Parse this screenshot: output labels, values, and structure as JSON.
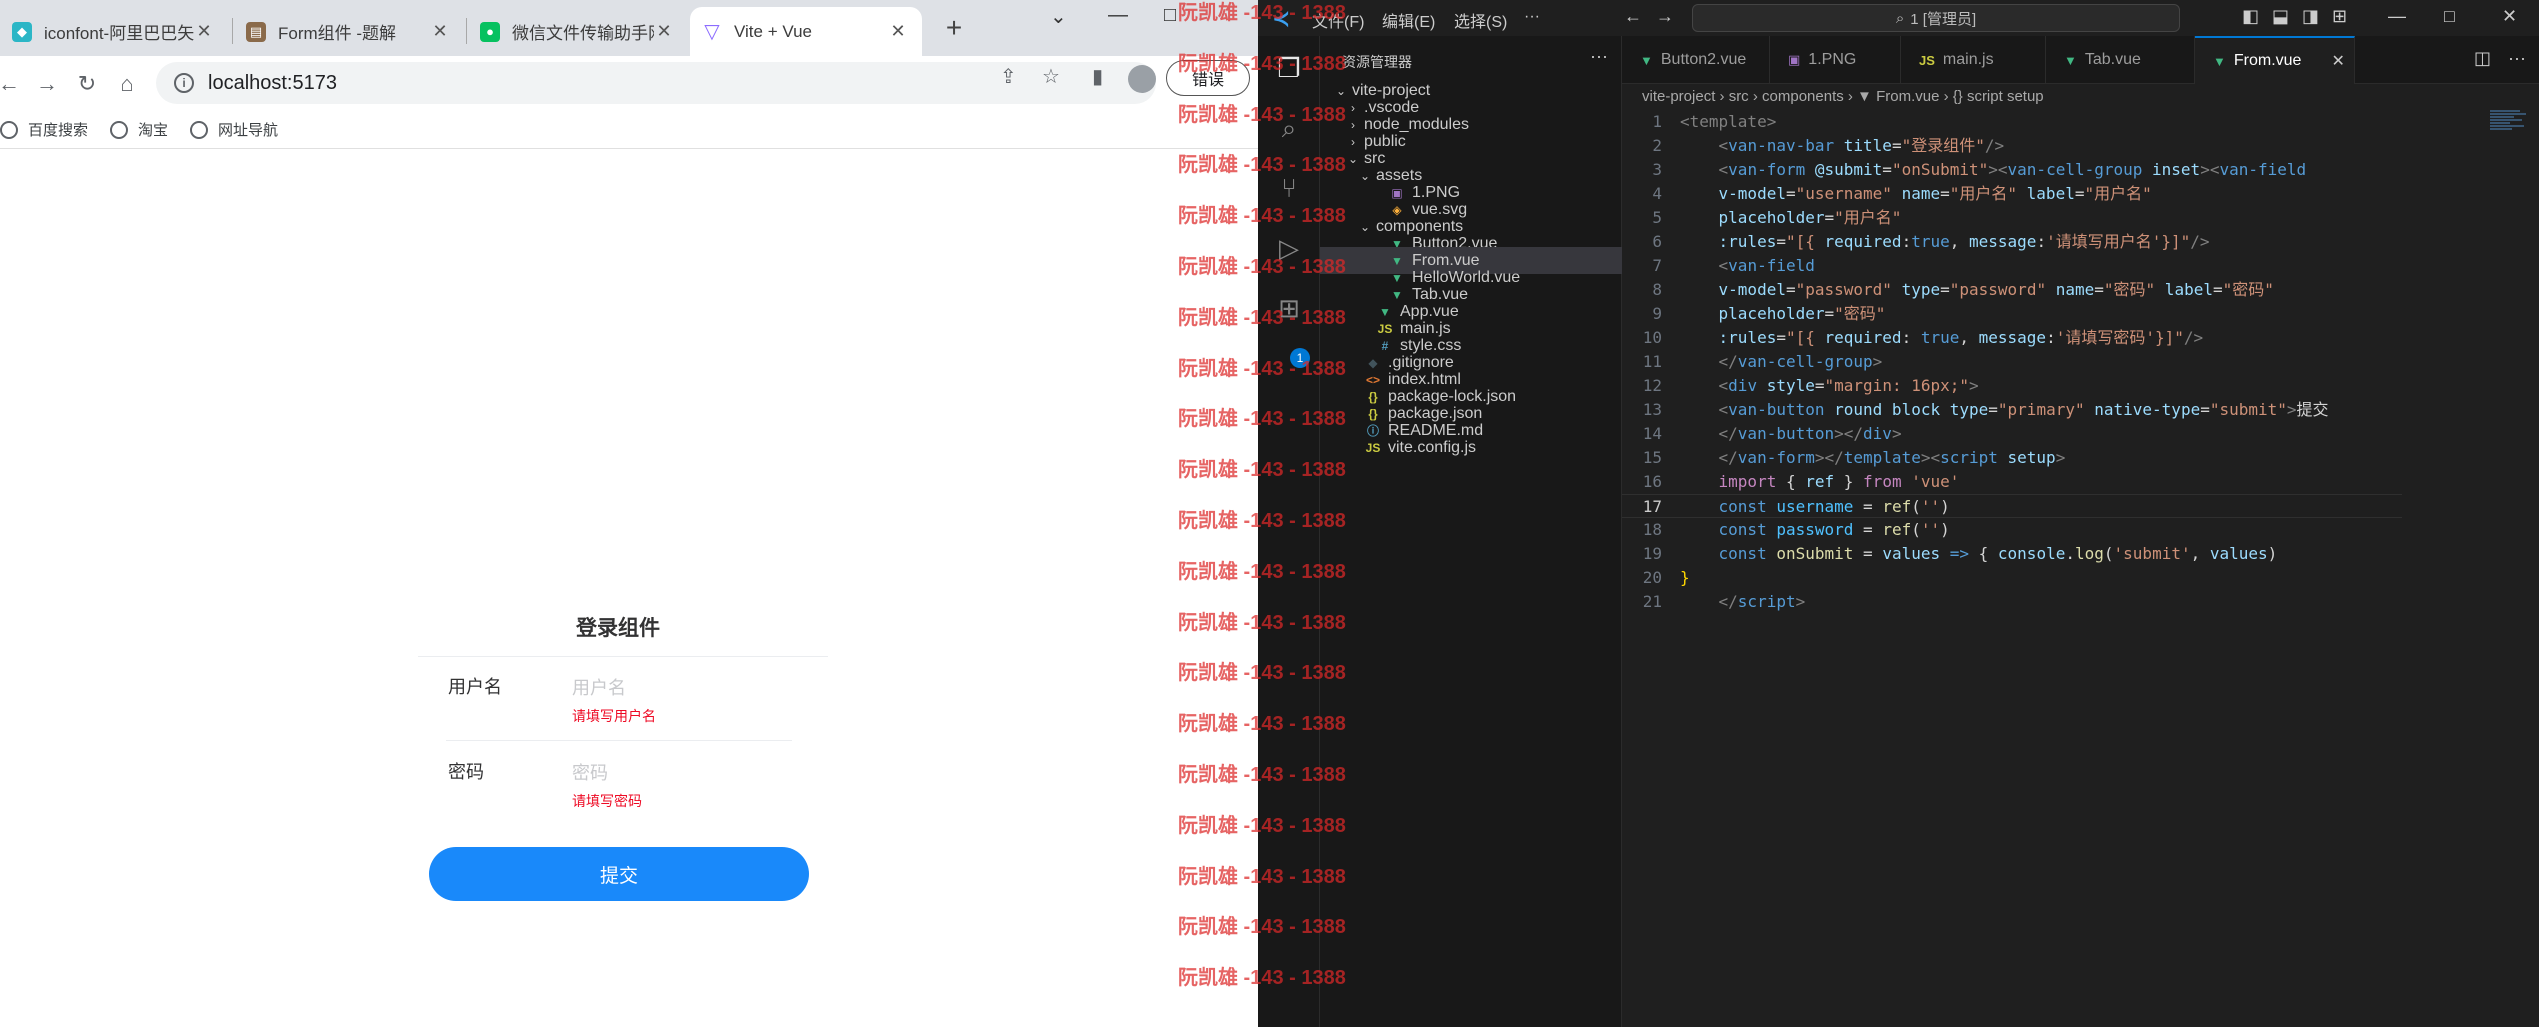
{
  "browser": {
    "tabs": [
      {
        "title": "iconfont-阿里巴巴矢量",
        "icon": "iconfont-favicon",
        "color": "#2bb6c6"
      },
      {
        "title": "Form组件 -题解",
        "icon": "doc-favicon",
        "color": "#8a6a4a"
      },
      {
        "title": "微信文件传输助手网页",
        "icon": "wechat-favicon",
        "color": "#07c160"
      },
      {
        "title": "Vite + Vue",
        "icon": "vite-favicon",
        "color": "#8c6cff"
      }
    ],
    "new_tab": "+",
    "window_controls": [
      "⌄",
      "—",
      "□"
    ],
    "url": "localhost:5173",
    "error_pill": "错误",
    "bookmarks": [
      "百度搜索",
      "淘宝",
      "网址导航"
    ]
  },
  "page": {
    "title": "登录组件",
    "fields": [
      {
        "label": "用户名",
        "placeholder": "用户名",
        "error": "请填写用户名"
      },
      {
        "label": "密码",
        "placeholder": "密码",
        "error": "请填写密码"
      }
    ],
    "submit": "提交",
    "accent": "#1989fa",
    "error_color": "#ee0a24"
  },
  "watermark": {
    "text": "阮凯雄 -143 - 1388"
  },
  "vscode": {
    "menu": [
      "文件(F)",
      "编辑(E)",
      "选择(S)",
      "···"
    ],
    "search": "1 [管理员]",
    "sidebar_title": "资源管理器",
    "sidebar_more": "···",
    "tree": [
      {
        "name": "vite-project",
        "depth": 0,
        "chevron": "⌄",
        "icon": "",
        "kind": "folder"
      },
      {
        "name": ".vscode",
        "depth": 1,
        "chevron": "›",
        "icon": "",
        "kind": "folder"
      },
      {
        "name": "node_modules",
        "depth": 1,
        "chevron": "›",
        "icon": "",
        "kind": "folder"
      },
      {
        "name": "public",
        "depth": 1,
        "chevron": "›",
        "icon": "",
        "kind": "folder"
      },
      {
        "name": "src",
        "depth": 1,
        "chevron": "⌄",
        "icon": "",
        "kind": "folder"
      },
      {
        "name": "assets",
        "depth": 2,
        "chevron": "⌄",
        "icon": "",
        "kind": "folder"
      },
      {
        "name": "1.PNG",
        "depth": 3,
        "chevron": "",
        "icon": "▣",
        "kind": "image"
      },
      {
        "name": "vue.svg",
        "depth": 3,
        "chevron": "",
        "icon": "◈",
        "kind": "svg"
      },
      {
        "name": "components",
        "depth": 2,
        "chevron": "⌄",
        "icon": "",
        "kind": "folder"
      },
      {
        "name": "Button2.vue",
        "depth": 3,
        "chevron": "",
        "icon": "▼",
        "kind": "vue"
      },
      {
        "name": "From.vue",
        "depth": 3,
        "chevron": "",
        "icon": "▼",
        "kind": "vue",
        "selected": true
      },
      {
        "name": "HelloWorld.vue",
        "depth": 3,
        "chevron": "",
        "icon": "▼",
        "kind": "vue"
      },
      {
        "name": "Tab.vue",
        "depth": 3,
        "chevron": "",
        "icon": "▼",
        "kind": "vue"
      },
      {
        "name": "App.vue",
        "depth": 2,
        "chevron": "",
        "icon": "▼",
        "kind": "vue"
      },
      {
        "name": "main.js",
        "depth": 2,
        "chevron": "",
        "icon": "JS",
        "kind": "js"
      },
      {
        "name": "style.css",
        "depth": 2,
        "chevron": "",
        "icon": "#",
        "kind": "css"
      },
      {
        "name": ".gitignore",
        "depth": 1,
        "chevron": "",
        "icon": "◆",
        "kind": "git"
      },
      {
        "name": "index.html",
        "depth": 1,
        "chevron": "",
        "icon": "<>",
        "kind": "html"
      },
      {
        "name": "package-lock.json",
        "depth": 1,
        "chevron": "",
        "icon": "{}",
        "kind": "json"
      },
      {
        "name": "package.json",
        "depth": 1,
        "chevron": "",
        "icon": "{}",
        "kind": "json"
      },
      {
        "name": "README.md",
        "depth": 1,
        "chevron": "",
        "icon": "ⓘ",
        "kind": "md"
      },
      {
        "name": "vite.config.js",
        "depth": 1,
        "chevron": "",
        "icon": "JS",
        "kind": "js"
      }
    ],
    "editor_tabs": [
      {
        "name": "Button2.vue",
        "icon": "▼",
        "kind": "vue"
      },
      {
        "name": "1.PNG",
        "icon": "▣",
        "kind": "image"
      },
      {
        "name": "main.js",
        "icon": "JS",
        "kind": "js"
      },
      {
        "name": "Tab.vue",
        "icon": "▼",
        "kind": "vue"
      },
      {
        "name": "From.vue",
        "icon": "▼",
        "kind": "vue",
        "active": true,
        "close": "✕"
      }
    ],
    "breadcrumb": "vite-project  ›  src  ›  components  ›  ▼ From.vue  ›  {} script setup",
    "current_line": 17,
    "code": [
      [
        [
          "<template>",
          "#808080"
        ]
      ],
      [
        [
          "    <",
          "#808080"
        ],
        [
          "van-nav-bar",
          "#569cd6"
        ],
        [
          " title",
          "#9cdcfe"
        ],
        [
          "=",
          "#d4d4d4"
        ],
        [
          "\"登录组件\"",
          "#ce9178"
        ],
        [
          "/>",
          "#808080"
        ]
      ],
      [
        [
          "    <",
          "#808080"
        ],
        [
          "van-form",
          "#569cd6"
        ],
        [
          " @submit",
          "#9cdcfe"
        ],
        [
          "=",
          "#d4d4d4"
        ],
        [
          "\"onSubmit\"",
          "#ce9178"
        ],
        [
          "><",
          "#808080"
        ],
        [
          "van-cell-group",
          "#569cd6"
        ],
        [
          " inset",
          "#9cdcfe"
        ],
        [
          "><",
          "#808080"
        ],
        [
          "van-field",
          "#569cd6"
        ]
      ],
      [
        [
          "    v-model",
          "#9cdcfe"
        ],
        [
          "=",
          "#d4d4d4"
        ],
        [
          "\"username\"",
          "#ce9178"
        ],
        [
          " name",
          "#9cdcfe"
        ],
        [
          "=",
          "#d4d4d4"
        ],
        [
          "\"用户名\"",
          "#ce9178"
        ],
        [
          " label",
          "#9cdcfe"
        ],
        [
          "=",
          "#d4d4d4"
        ],
        [
          "\"用户名\"",
          "#ce9178"
        ]
      ],
      [
        [
          "    placeholder",
          "#9cdcfe"
        ],
        [
          "=",
          "#d4d4d4"
        ],
        [
          "\"用户名\"",
          "#ce9178"
        ]
      ],
      [
        [
          "    :rules",
          "#9cdcfe"
        ],
        [
          "=",
          "#d4d4d4"
        ],
        [
          "\"[{ ",
          "#ce9178"
        ],
        [
          "required",
          "#9cdcfe"
        ],
        [
          ":",
          "#d4d4d4"
        ],
        [
          "true",
          "#569cd6"
        ],
        [
          ", ",
          "#d4d4d4"
        ],
        [
          "message",
          "#9cdcfe"
        ],
        [
          ":",
          "#d4d4d4"
        ],
        [
          "'请填写用户名'",
          "#ce9178"
        ],
        [
          "}]\"",
          "#ce9178"
        ],
        [
          "/>",
          "#808080"
        ]
      ],
      [
        [
          "    <",
          "#808080"
        ],
        [
          "van-field",
          "#569cd6"
        ]
      ],
      [
        [
          "    v-model",
          "#9cdcfe"
        ],
        [
          "=",
          "#d4d4d4"
        ],
        [
          "\"password\"",
          "#ce9178"
        ],
        [
          " type",
          "#9cdcfe"
        ],
        [
          "=",
          "#d4d4d4"
        ],
        [
          "\"password\"",
          "#ce9178"
        ],
        [
          " name",
          "#9cdcfe"
        ],
        [
          "=",
          "#d4d4d4"
        ],
        [
          "\"密码\"",
          "#ce9178"
        ],
        [
          " label",
          "#9cdcfe"
        ],
        [
          "=",
          "#d4d4d4"
        ],
        [
          "\"密码\"",
          "#ce9178"
        ]
      ],
      [
        [
          "    placeholder",
          "#9cdcfe"
        ],
        [
          "=",
          "#d4d4d4"
        ],
        [
          "\"密码\"",
          "#ce9178"
        ]
      ],
      [
        [
          "    :rules",
          "#9cdcfe"
        ],
        [
          "=",
          "#d4d4d4"
        ],
        [
          "\"[{ ",
          "#ce9178"
        ],
        [
          "required",
          "#9cdcfe"
        ],
        [
          ": ",
          "#d4d4d4"
        ],
        [
          "true",
          "#569cd6"
        ],
        [
          ", ",
          "#d4d4d4"
        ],
        [
          "message",
          "#9cdcfe"
        ],
        [
          ":",
          "#d4d4d4"
        ],
        [
          "'请填写密码'",
          "#ce9178"
        ],
        [
          "}]\"",
          "#ce9178"
        ],
        [
          "/>",
          "#808080"
        ]
      ],
      [
        [
          "    </",
          "#808080"
        ],
        [
          "van-cell-group",
          "#569cd6"
        ],
        [
          ">",
          "#808080"
        ]
      ],
      [
        [
          "    <",
          "#808080"
        ],
        [
          "div",
          "#569cd6"
        ],
        [
          " style",
          "#9cdcfe"
        ],
        [
          "=",
          "#d4d4d4"
        ],
        [
          "\"margin: 16px;\"",
          "#ce9178"
        ],
        [
          ">",
          "#808080"
        ]
      ],
      [
        [
          "    <",
          "#808080"
        ],
        [
          "van-button",
          "#569cd6"
        ],
        [
          " round block type",
          "#9cdcfe"
        ],
        [
          "=",
          "#d4d4d4"
        ],
        [
          "\"primary\"",
          "#ce9178"
        ],
        [
          " native-type",
          "#9cdcfe"
        ],
        [
          "=",
          "#d4d4d4"
        ],
        [
          "\"submit\"",
          "#ce9178"
        ],
        [
          ">",
          "#808080"
        ],
        [
          "提交",
          "#d4d4d4"
        ]
      ],
      [
        [
          "    </",
          "#808080"
        ],
        [
          "van-button",
          "#569cd6"
        ],
        [
          "></",
          "#808080"
        ],
        [
          "div",
          "#569cd6"
        ],
        [
          ">",
          "#808080"
        ]
      ],
      [
        [
          "    </",
          "#808080"
        ],
        [
          "van-form",
          "#569cd6"
        ],
        [
          "></",
          "#808080"
        ],
        [
          "template",
          "#569cd6"
        ],
        [
          "><",
          "#808080"
        ],
        [
          "script",
          "#569cd6"
        ],
        [
          " setup",
          "#9cdcfe"
        ],
        [
          ">",
          "#808080"
        ]
      ],
      [
        [
          "    import",
          "#c586c0"
        ],
        [
          " { ",
          "#d4d4d4"
        ],
        [
          "ref",
          "#9cdcfe"
        ],
        [
          " } ",
          "#d4d4d4"
        ],
        [
          "from",
          "#c586c0"
        ],
        [
          " 'vue'",
          "#ce9178"
        ]
      ],
      [
        [
          "    const",
          "#569cd6"
        ],
        [
          " username",
          "#4fc1ff"
        ],
        [
          " = ",
          "#d4d4d4"
        ],
        [
          "ref",
          "#dcdcaa"
        ],
        [
          "(",
          "#d4d4d4"
        ],
        [
          "''",
          "#ce9178"
        ],
        [
          ")",
          "#d4d4d4"
        ]
      ],
      [
        [
          "    const",
          "#569cd6"
        ],
        [
          " password",
          "#4fc1ff"
        ],
        [
          " = ",
          "#d4d4d4"
        ],
        [
          "ref",
          "#dcdcaa"
        ],
        [
          "(",
          "#d4d4d4"
        ],
        [
          "''",
          "#ce9178"
        ],
        [
          ")",
          "#d4d4d4"
        ]
      ],
      [
        [
          "    const",
          "#569cd6"
        ],
        [
          " onSubmit",
          "#dcdcaa"
        ],
        [
          " = ",
          "#d4d4d4"
        ],
        [
          "values",
          "#9cdcfe"
        ],
        [
          " => ",
          "#569cd6"
        ],
        [
          "{ ",
          "#d4d4d4"
        ],
        [
          "console",
          "#9cdcfe"
        ],
        [
          ".",
          "#d4d4d4"
        ],
        [
          "log",
          "#dcdcaa"
        ],
        [
          "(",
          "#d4d4d4"
        ],
        [
          "'submit'",
          "#ce9178"
        ],
        [
          ", ",
          "#d4d4d4"
        ],
        [
          "values",
          "#9cdcfe"
        ],
        [
          ")",
          "#d4d4d4"
        ]
      ],
      [
        [
          "}",
          "#ffd700"
        ]
      ],
      [
        [
          "    </",
          "#808080"
        ],
        [
          "script",
          "#569cd6"
        ],
        [
          ">",
          "#808080"
        ]
      ]
    ]
  }
}
